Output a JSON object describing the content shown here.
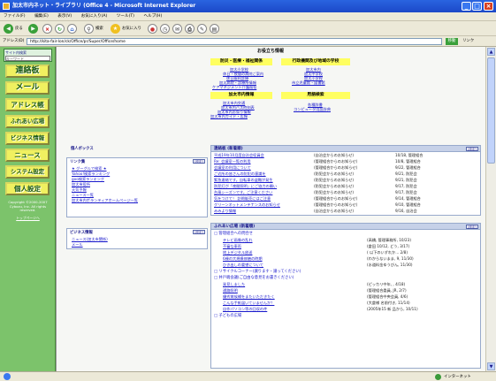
{
  "window": {
    "title": "加太市内ネット・ライブラリ (Office 4 - Microsoft Internet Explorer"
  },
  "menu": [
    "ファイル(F)",
    "編集(E)",
    "表示(V)",
    "お気に入り(A)",
    "ツール(T)",
    "ヘルプ(H)"
  ],
  "toolbar": {
    "back": "戻る",
    "search": "検索",
    "favorites": "お気に入り"
  },
  "address": {
    "label": "アドレス(D)",
    "url": "http://kita-fair-lon/ck/Office/pr/Super/Office/home",
    "go": "移動",
    "links": "リンク"
  },
  "sidebar": {
    "search_label": "サイト内検索",
    "search_value": "キーワード",
    "nav": [
      "連絡板",
      "メール",
      "アドレス帳",
      "ふれあい広場",
      "ビジネス情報",
      "ニュース",
      "システム設定",
      "個人設定"
    ],
    "copyright": "Copyright ©2000-2007 Cybozu, Inc. All rights reserved.",
    "footer_link": "トップページへ"
  },
  "page": {
    "title": "お役立ち情報"
  },
  "info": {
    "col1_header": "防災・医療・福祉関係",
    "col2_header": "行政機関及び地域の学校",
    "col1_links": [
      "加太小学校",
      "休日・夜間の病院ご案内",
      "休日歯科診療",
      "加太病院・診療所情報",
      "ケアマネジメント介護福祉"
    ],
    "col2_links": [
      "加太市内",
      "加太中学校",
      "加太小学校",
      "市立児童館・図書館"
    ],
    "col3_header": "加太市内情報",
    "col4_header": "用語検索",
    "col3_links": [
      "加太市内交通",
      "加太市内バス時刻表",
      "加太市内お祭り情報",
      "加太市内ガイド・広報"
    ],
    "col4_links": [
      "各種辞書",
      "コンピュータ用語辞典"
    ]
  },
  "personal": {
    "title": "個人ボックス",
    "links_title": "リンク集",
    "links_button": "[設定]",
    "links": [
      "★ グーグルで検索 ★",
      "Yahoo!検索ランキング",
      "goo検索ランキング",
      "加太市役所",
      "天気予報",
      "ニュース一覧",
      "加太市内ボランティアホームページ一覧"
    ],
    "biz_title": "ビジネス情報",
    "biz_button": "[設定]",
    "biz_links": [
      "ニュース(加太市関係)",
      "メール"
    ]
  },
  "notices": {
    "title": "連絡板 (新着順)",
    "button": "[設定]",
    "items": [
      {
        "title": "平成19年10月度自治会役員会",
        "from": "(自治会からのお知らせ)",
        "date": "10/18, 管理組合"
      },
      {
        "title": "Re: 会議室一覧の利用",
        "from": "(管理組合からのお知らせ)",
        "date": "10/8, 管理組合"
      },
      {
        "title": "会議室の利用について",
        "from": "(管理組合からのお知らせ)",
        "date": "9/22, 管理組合"
      },
      {
        "title": "ご近所の皆さんの防犯の意識を",
        "from": "(防犯会からのお知らせ)",
        "date": "9/21, 防犯会"
      },
      {
        "title": "緊急連絡です。自転車の盗難が発生",
        "from": "(防犯会からのお知らせ)",
        "date": "9/21, 防犯会"
      },
      {
        "title": "防犯灯が「夜間照明」にご協力の願い",
        "from": "(防犯会からのお知らせ)",
        "date": "9/17, 防犯会"
      },
      {
        "title": "台風シーズンです。ご注意ください",
        "from": "(防犯会からのお知らせ)",
        "date": "9/17, 防犯会"
      },
      {
        "title": "気をつけて！ 訪問販売にはご注意",
        "from": "(管理組合からのお知らせ)",
        "date": "9/14, 管理組合"
      },
      {
        "title": "グリーンネットメンテナンスのお知らせ",
        "from": "(管理組合からのお知らせ)",
        "date": "9/10, 管理組合"
      },
      {
        "title": "みみより情報",
        "from": "(自治会からのお知らせ)",
        "date": "9/16, 自治会"
      }
    ]
  },
  "forum": {
    "title": "ふれあい広場 (新着順)",
    "button": "[設定]",
    "sections": [
      {
        "head": "□ 管理組合への問合せ",
        "items": [
          {
            "title": "テレビ画像の乱れ",
            "meta": "(高橋, 管理事務所, 10/23)"
          },
          {
            "title": "不審な車両",
            "meta": "(倉田 10/12, どう, 3/17)"
          },
          {
            "title": "地上デジタル放送",
            "meta": "( 以下のいずれか... 2/8)"
          },
          {
            "title": "6棟の大規模修繕の時期",
            "meta": "(わからないまま, 9, 11/30)"
          },
          {
            "title": "ひき出しの要望について",
            "meta": "(水道料金ゆうびん, 11/30)"
          }
        ]
      },
      {
        "head": "□ リサイクルコーナー(譲ります・譲ってください)",
        "items": []
      },
      {
        "head": "□ 井戸端会議(ご自由な意見をお書きください)",
        "items": [
          {
            "title": "発見しました",
            "meta": "(ピッカリ中年,  , 4/18)"
          },
          {
            "title": "通路照明",
            "meta": "(管理組合委員, JR, 2/7)"
          },
          {
            "title": "優秀賞候補をまたいただきたく",
            "meta": "(管理組合中央会員, 4/6)"
          },
          {
            "title": "こんな手紙届いていませんか？",
            "meta": "(大倉様 名前付き, 11/14)"
          },
          {
            "title": "自作パソコン等の回収の件",
            "meta": "(2005年15 新 品から, 10/11)"
          }
        ]
      },
      {
        "head": "□ 子どもの広場",
        "items": []
      }
    ]
  },
  "status": {
    "left": "",
    "zone": "インターネット"
  }
}
